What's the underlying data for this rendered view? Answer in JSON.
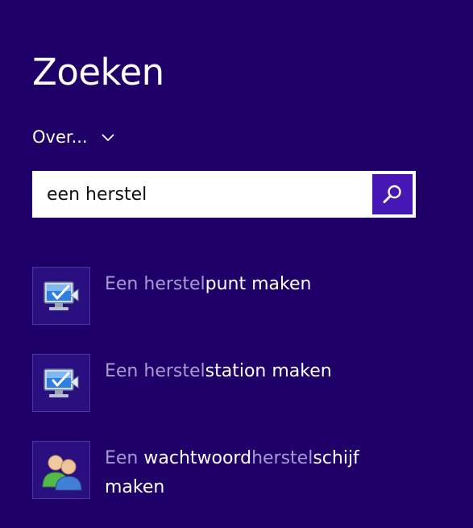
{
  "header": {
    "title": "Zoeken"
  },
  "scope": {
    "label": "Over...",
    "icon": "chevron-down-icon"
  },
  "search": {
    "value": "een herstel",
    "button_icon": "search-icon"
  },
  "results": [
    {
      "icon": "system-restore-icon",
      "parts": [
        {
          "text": "Een ",
          "style": "dim"
        },
        {
          "text": "herstel",
          "style": "dim"
        },
        {
          "text": "punt maken",
          "style": "bright"
        }
      ]
    },
    {
      "icon": "system-restore-icon",
      "parts": [
        {
          "text": "Een ",
          "style": "dim"
        },
        {
          "text": "herstel",
          "style": "dim"
        },
        {
          "text": "station maken",
          "style": "bright"
        }
      ]
    },
    {
      "icon": "user-accounts-icon",
      "parts": [
        {
          "text": "Een ",
          "style": "dim"
        },
        {
          "text": "wachtwoord",
          "style": "bright"
        },
        {
          "text": "herstel",
          "style": "dim"
        },
        {
          "text": "schijf maken",
          "style": "bright"
        }
      ]
    }
  ],
  "colors": {
    "background": "#1f0068",
    "accent": "#4617b4",
    "dim_text": "#a89bd4"
  }
}
